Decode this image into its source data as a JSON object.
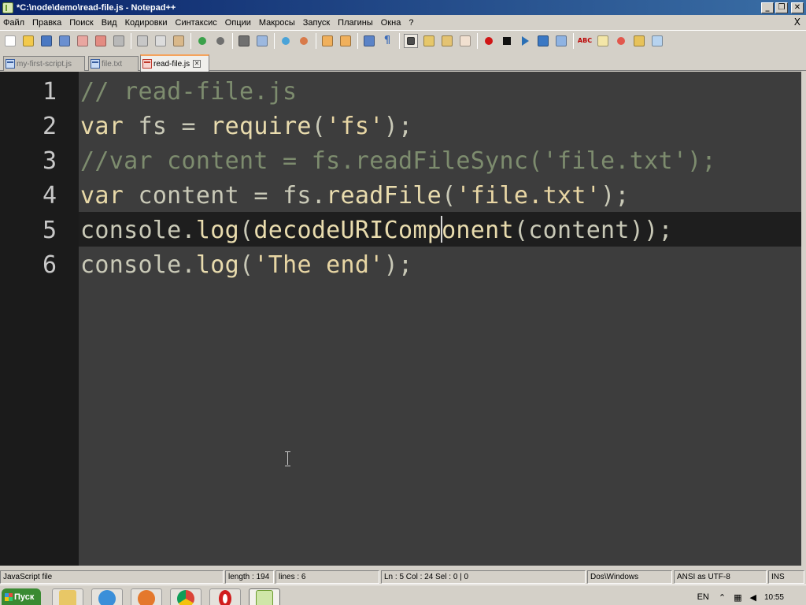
{
  "window": {
    "title": "*C:\\node\\demo\\read-file.js - Notepad++",
    "minimize": "_",
    "restore": "❐",
    "close": "✕"
  },
  "menu": {
    "items": [
      "Файл",
      "Правка",
      "Поиск",
      "Вид",
      "Кодировки",
      "Синтаксис",
      "Опции",
      "Макросы",
      "Запуск",
      "Плагины",
      "Окна",
      "?"
    ],
    "close": "X"
  },
  "toolbar": {
    "buttons": [
      "new-file-icon",
      "open-file-icon",
      "save-icon",
      "save-all-icon",
      "close-file-icon",
      "close-all-icon",
      "print-icon",
      "cut-icon",
      "copy-icon",
      "paste-icon",
      "undo-icon",
      "redo-icon",
      "find-icon",
      "replace-icon",
      "zoom-in-icon",
      "zoom-out-icon",
      "sync-vertical-icon",
      "sync-horizontal-icon",
      "word-wrap-icon",
      "show-all-chars-icon",
      "indent-guide-icon",
      "user-language-icon",
      "doc-map-icon",
      "function-list-icon",
      "record-macro-icon",
      "stop-macro-icon",
      "play-macro-icon",
      "run-macro-multiple-icon",
      "save-macro-icon",
      "spell-check-icon",
      "spell-next-icon",
      "bookmark-icon",
      "folder-icon",
      "abc-check-icon"
    ],
    "abc": "ABC"
  },
  "tabs": [
    {
      "label": "my-first-script.js",
      "active": false
    },
    {
      "label": "file.txt",
      "active": false
    },
    {
      "label": "read-file.js",
      "active": true
    }
  ],
  "editor": {
    "lines": [
      {
        "num": "1",
        "tokens": [
          {
            "t": "// read-file.js",
            "c": "cm"
          }
        ]
      },
      {
        "num": "2",
        "tokens": [
          {
            "t": "var",
            "c": "kw"
          },
          {
            "t": " fs = ",
            "c": "id"
          },
          {
            "t": "require",
            "c": "df"
          },
          {
            "t": "(",
            "c": "id"
          },
          {
            "t": "'fs'",
            "c": "st"
          },
          {
            "t": ");",
            "c": "id"
          }
        ]
      },
      {
        "num": "3",
        "tokens": [
          {
            "t": "//var content = fs.readFileSync('file.txt');",
            "c": "cm"
          }
        ]
      },
      {
        "num": "4",
        "tokens": [
          {
            "t": "var",
            "c": "kw"
          },
          {
            "t": " content = fs.",
            "c": "id"
          },
          {
            "t": "readFile",
            "c": "df"
          },
          {
            "t": "(",
            "c": "id"
          },
          {
            "t": "'file.txt'",
            "c": "st"
          },
          {
            "t": ");",
            "c": "id"
          }
        ]
      },
      {
        "num": "5",
        "tokens": [
          {
            "t": "console.",
            "c": "id"
          },
          {
            "t": "log",
            "c": "df"
          },
          {
            "t": "(",
            "c": "id"
          },
          {
            "t": "decodeURIComponent",
            "c": "df"
          },
          {
            "t": "(content));",
            "c": "id"
          }
        ]
      },
      {
        "num": "6",
        "tokens": [
          {
            "t": "console.",
            "c": "id"
          },
          {
            "t": "log",
            "c": "df"
          },
          {
            "t": "(",
            "c": "id"
          },
          {
            "t": "'The end'",
            "c": "st"
          },
          {
            "t": ");",
            "c": "id"
          }
        ]
      }
    ],
    "current_line": 5
  },
  "status": {
    "language": "JavaScript file",
    "length": "length : 194",
    "lines": "lines : 6",
    "position": "Ln : 5    Col : 24    Sel : 0 | 0",
    "eol": "Dos\\Windows",
    "encoding": "ANSI as UTF-8",
    "mode": "INS"
  },
  "taskbar": {
    "start": "Пуск",
    "lang": "EN",
    "time": "10:55"
  }
}
